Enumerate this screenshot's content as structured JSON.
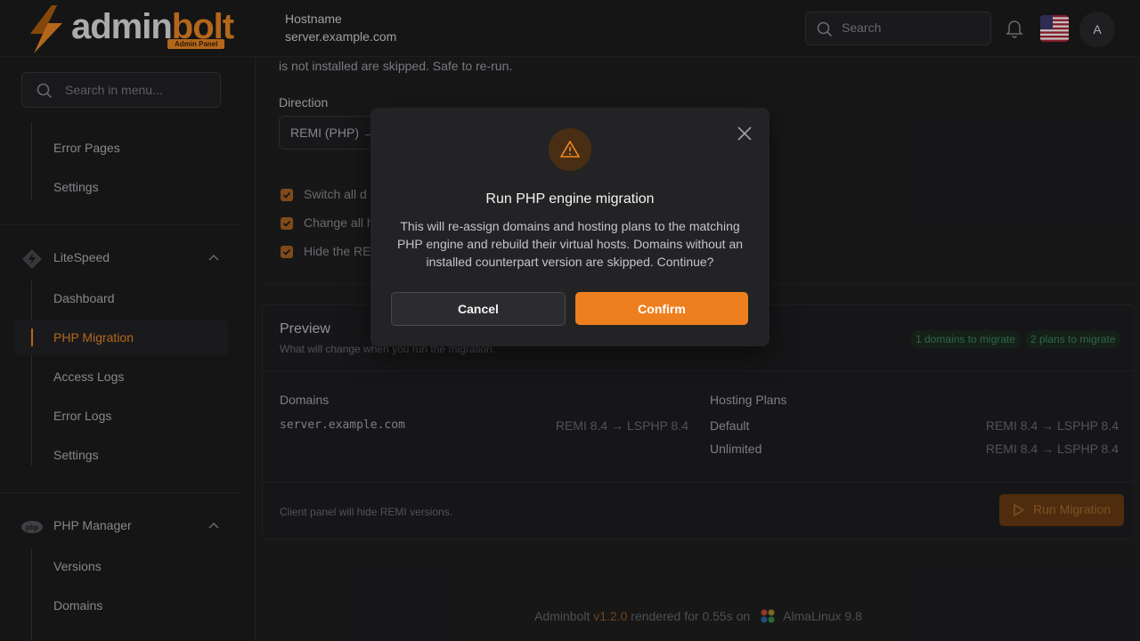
{
  "brand": {
    "name_main": "admin",
    "name_accent": "bolt",
    "badge": "Admin Panel",
    "accent_color": "#f08a24"
  },
  "header": {
    "hostname_label": "Hostname",
    "hostname_value": "server.example.com",
    "search_placeholder": "Search",
    "avatar_initial": "A",
    "icons": [
      "bell-icon",
      "us-flag-icon"
    ]
  },
  "sidebar": {
    "search_placeholder": "Search in menu...",
    "top_items": [
      "Error Pages",
      "Settings"
    ],
    "groups": [
      {
        "label": "LiteSpeed",
        "items": [
          "Dashboard",
          "PHP Migration",
          "Access Logs",
          "Error Logs",
          "Settings"
        ],
        "active": "PHP Migration"
      },
      {
        "label": "PHP Manager",
        "items": [
          "Versions",
          "Domains"
        ]
      }
    ]
  },
  "main": {
    "fragment_text": "is not installed are skipped. Safe to re-run.",
    "direction_label": "Direction",
    "direction_value": "REMI (PHP) →",
    "checkboxes": [
      "Switch all d",
      "Change all h",
      "Hide the RE"
    ],
    "preview": {
      "title": "Preview",
      "subtitle": "What will change when you run the migration.",
      "badges": [
        "1 domains to migrate",
        "2 plans to migrate"
      ],
      "badge_color": "#3f8a5a",
      "domains_header": "Domains",
      "domains": [
        {
          "name": "server.example.com",
          "change": "REMI 8.4 → LSPHP 8.4"
        }
      ],
      "plans_header": "Hosting Plans",
      "plans": [
        {
          "name": "Default",
          "change": "REMI 8.4 → LSPHP 8.4"
        },
        {
          "name": "Unlimited",
          "change": "REMI 8.4 → LSPHP 8.4"
        }
      ],
      "footer_note": "Client panel will hide REMI versions.",
      "run_button": "Run Migration"
    },
    "footer": {
      "app": "Adminbolt",
      "version": "v1.2.0",
      "rendered": "rendered for 0.55s on",
      "os": "AlmaLinux 9.8"
    }
  },
  "modal": {
    "title": "Run PHP engine migration",
    "body": "This will re-assign domains and hosting plans to the matching PHP engine and rebuild their virtual hosts. Domains without an installed counterpart version are skipped. Continue?",
    "cancel": "Cancel",
    "confirm": "Confirm",
    "confirm_color": "#ee7f1f"
  }
}
